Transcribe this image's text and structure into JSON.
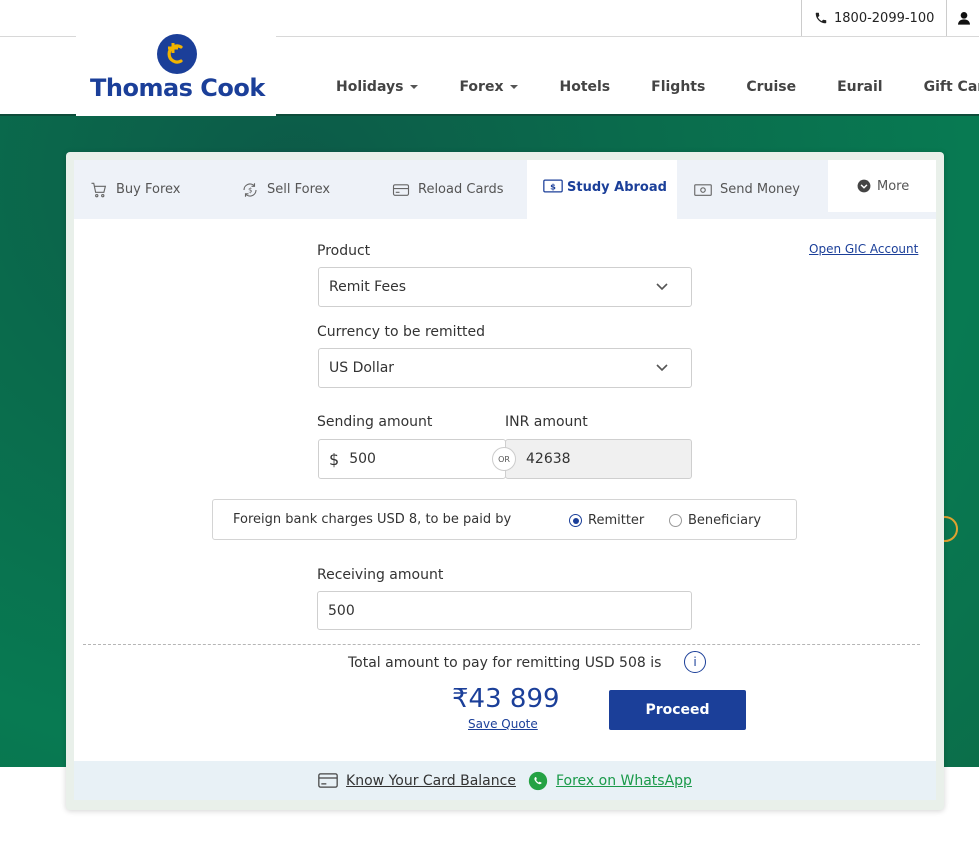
{
  "topbar": {
    "phone": "1800-2099-100"
  },
  "brand": {
    "name": "Thomas Cook"
  },
  "nav": {
    "items": [
      {
        "label": "Holidays",
        "dropdown": true
      },
      {
        "label": "Forex",
        "dropdown": true
      },
      {
        "label": "Hotels",
        "dropdown": false
      },
      {
        "label": "Flights",
        "dropdown": false
      },
      {
        "label": "Cruise",
        "dropdown": false
      },
      {
        "label": "Eurail",
        "dropdown": false
      },
      {
        "label": "Gift Car",
        "dropdown": false
      }
    ]
  },
  "tabs": [
    {
      "label": "Buy Forex",
      "icon": "cart-icon"
    },
    {
      "label": "Sell Forex",
      "icon": "exchange-icon"
    },
    {
      "label": "Reload Cards",
      "icon": "card-icon"
    },
    {
      "label": "Study Abroad",
      "icon": "money-icon",
      "active": true
    },
    {
      "label": "Send Money",
      "icon": "banknote-icon"
    },
    {
      "label": "More",
      "icon": "chevron-down-icon"
    }
  ],
  "form": {
    "product_label": "Product",
    "product_value": "Remit Fees",
    "open_gic": "Open GIC Account",
    "currency_label": "Currency to be remitted",
    "currency_value": "US Dollar",
    "sending_label": "Sending amount",
    "sending_symbol": "$",
    "sending_value": "500",
    "inr_label": "INR amount",
    "inr_value": "42638",
    "or": "OR",
    "charges_text": "Foreign bank charges USD 8, to be paid by",
    "radio_remitter": "Remitter",
    "radio_beneficiary": "Beneficiary",
    "receiving_label": "Receiving amount",
    "receiving_value": "500"
  },
  "summary": {
    "total_text": "Total amount to pay for remitting USD 508 is",
    "info": "i",
    "currency_symbol": "₹",
    "amount": "43 899",
    "save_quote": "Save Quote",
    "proceed": "Proceed"
  },
  "footer": {
    "card_balance": "Know Your Card Balance",
    "whatsapp": "Forex on WhatsApp"
  },
  "colors": {
    "brand_blue": "#1b3f99",
    "green_band": "#087a52",
    "whatsapp_green": "#1a9a4a",
    "logo_yellow": "#f2b400"
  }
}
